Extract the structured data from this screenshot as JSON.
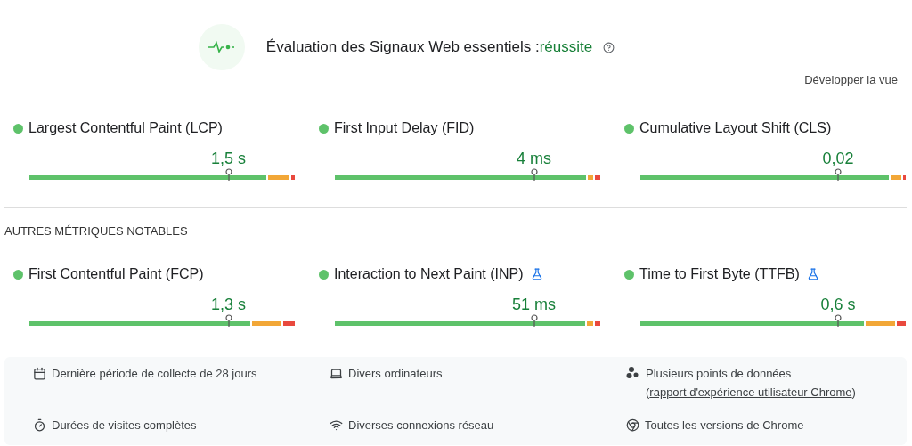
{
  "header": {
    "title": "Évaluation des Signaux Web essentiels :",
    "result": "réussite"
  },
  "expand_link": "Développer la vue",
  "core_metrics": [
    {
      "name": "Largest Contentful Paint (LCP)",
      "color": "#5ec26a",
      "experimental": false,
      "value": "1,5 s",
      "segments": [
        {
          "kind": "good"
        },
        {
          "kind": "average"
        },
        {
          "kind": "poor"
        }
      ]
    },
    {
      "name": "First Input Delay (FID)",
      "color": "#5ec26a",
      "experimental": false,
      "value": "4 ms",
      "segments": [
        {
          "kind": "good"
        },
        {
          "kind": "average"
        },
        {
          "kind": "poor"
        }
      ]
    },
    {
      "name": "Cumulative Layout Shift (CLS)",
      "color": "#5ec26a",
      "experimental": false,
      "value": "0,02",
      "segments": [
        {
          "kind": "good"
        },
        {
          "kind": "average"
        },
        {
          "kind": "poor"
        }
      ]
    }
  ],
  "other_title": "AUTRES MÉTRIQUES NOTABLES",
  "other_metrics": [
    {
      "name": "First Contentful Paint (FCP)",
      "color": "#5ec26a",
      "experimental": false,
      "value": "1,3 s",
      "segments": [
        {
          "kind": "good"
        },
        {
          "kind": "average"
        },
        {
          "kind": "poor"
        }
      ]
    },
    {
      "name": "Interaction to Next Paint (INP)",
      "color": "#5ec26a",
      "experimental": true,
      "value": "51 ms",
      "segments": [
        {
          "kind": "good"
        },
        {
          "kind": "average"
        },
        {
          "kind": "poor"
        }
      ]
    },
    {
      "name": "Time to First Byte (TTFB)",
      "color": "#5ec26a",
      "experimental": true,
      "value": "0,6 s",
      "segments": [
        {
          "kind": "good"
        },
        {
          "kind": "average"
        },
        {
          "kind": "poor"
        }
      ]
    }
  ],
  "footer": [
    {
      "text": "Dernière période de collecte de 28 jours"
    },
    {
      "text": "Divers ordinateurs"
    },
    {
      "text": "Plusieurs points de données (",
      "link": "rapport d'expérience utilisateur Chrome",
      "after": ")"
    },
    {
      "text": "Durées de visites complètes"
    },
    {
      "text": "Diverses connexions réseau"
    },
    {
      "text": "Toutes les versions de Chrome"
    }
  ]
}
